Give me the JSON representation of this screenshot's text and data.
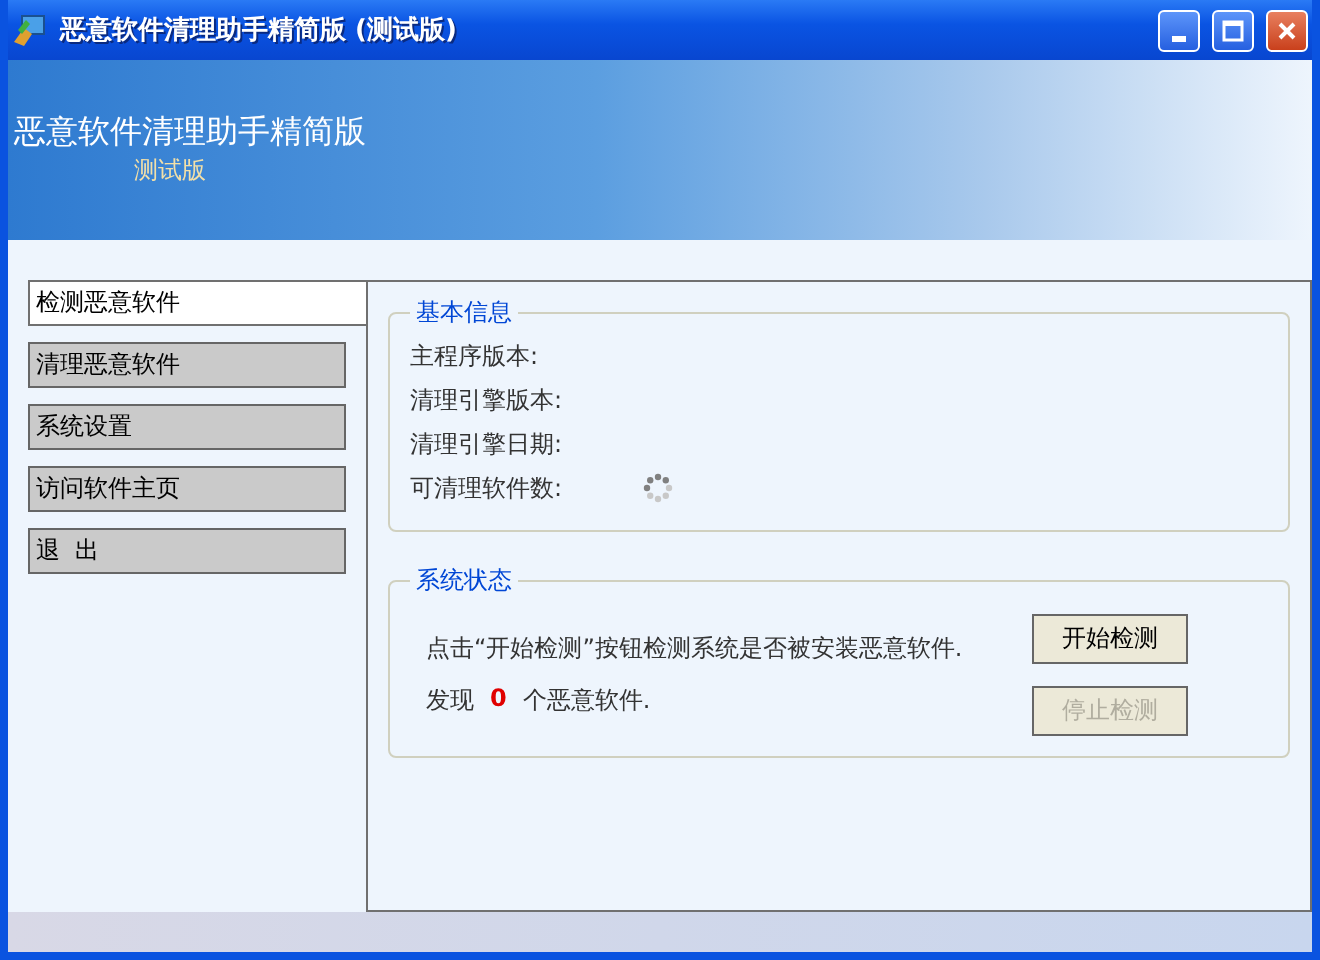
{
  "window": {
    "title": "恶意软件清理助手精简版 (测试版)"
  },
  "banner": {
    "title": "恶意软件清理助手精简版",
    "subtitle": "测试版"
  },
  "nav": [
    {
      "label": "检测恶意软件",
      "selected": true
    },
    {
      "label": "清理恶意软件",
      "selected": false
    },
    {
      "label": "系统设置",
      "selected": false
    },
    {
      "label": "访问软件主页",
      "selected": false
    },
    {
      "label": "退  出",
      "selected": false
    }
  ],
  "basic_info": {
    "title": "基本信息",
    "rows": [
      {
        "label": "主程序版本:",
        "loading": false
      },
      {
        "label": "清理引擎版本:",
        "loading": false
      },
      {
        "label": "清理引擎日期:",
        "loading": false
      },
      {
        "label": "可清理软件数:",
        "loading": true
      }
    ]
  },
  "system_status": {
    "title": "系统状态",
    "message": "点击“开始检测”按钮检测系统是否被安装恶意软件.",
    "found_prefix": "发现",
    "found_count": "0",
    "found_suffix": "个恶意软件.",
    "buttons": [
      {
        "label": "开始检测",
        "disabled": false
      },
      {
        "label": "停止检测",
        "disabled": true
      }
    ]
  }
}
